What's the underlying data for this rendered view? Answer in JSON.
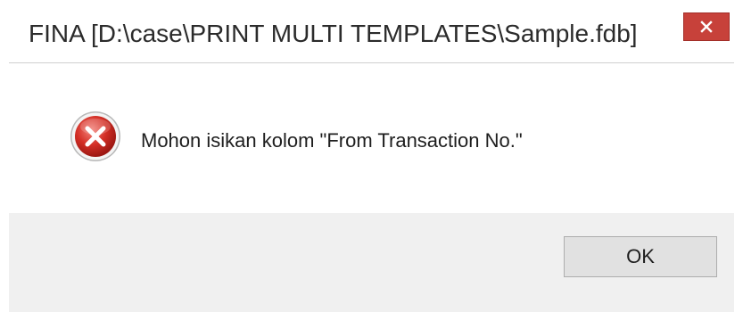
{
  "window": {
    "title": "FINA  [D:\\case\\PRINT MULTI TEMPLATES\\Sample.fdb]",
    "close_icon": "close-icon",
    "close_color": "#c7413a"
  },
  "dialog": {
    "icon": "error-icon",
    "message": "Mohon isikan kolom \"From Transaction No.\"",
    "ok_label": "OK"
  }
}
